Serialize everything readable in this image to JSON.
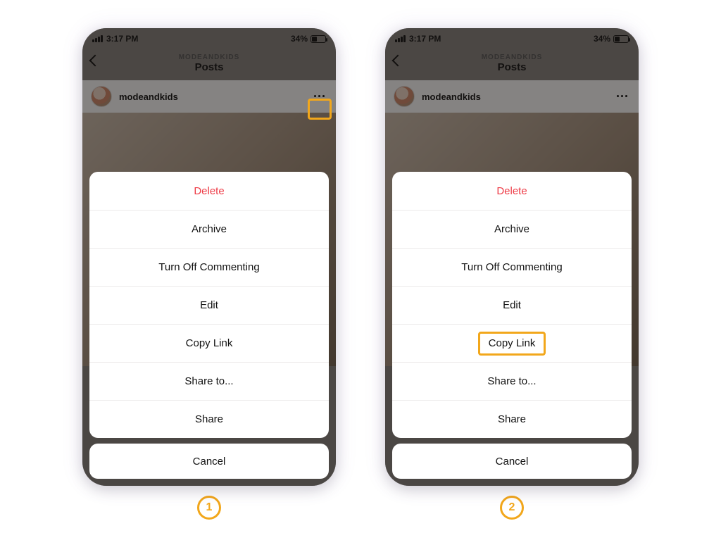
{
  "status": {
    "time": "3:17 PM",
    "battery_label": "34%"
  },
  "nav": {
    "account": "MODEANDKIDS",
    "title": "Posts"
  },
  "post": {
    "username": "modeandkids"
  },
  "menu": {
    "delete": "Delete",
    "archive": "Archive",
    "turn_off_commenting": "Turn Off Commenting",
    "edit": "Edit",
    "copy_link": "Copy Link",
    "share_to": "Share to...",
    "share": "Share",
    "cancel": "Cancel"
  },
  "steps": {
    "one": "1",
    "two": "2"
  }
}
